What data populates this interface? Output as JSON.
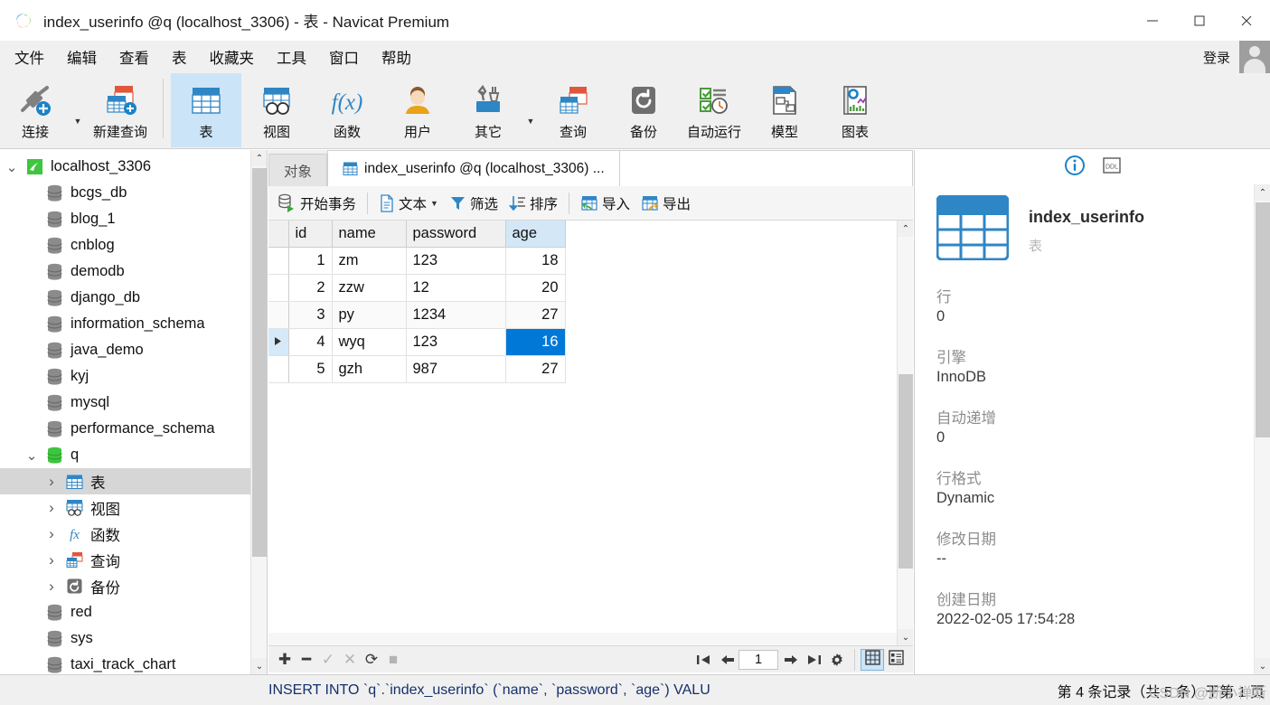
{
  "window": {
    "title": "index_userinfo @q (localhost_3306) - 表 - Navicat Premium",
    "minimize": "—",
    "maximize": "□",
    "close": "✕"
  },
  "menubar": {
    "items": [
      "文件",
      "编辑",
      "查看",
      "表",
      "收藏夹",
      "工具",
      "窗口",
      "帮助"
    ],
    "login_label": "登录"
  },
  "toolbar": {
    "buttons": [
      {
        "label": "连接",
        "icon": "connection-icon",
        "caret": true,
        "selected": false
      },
      {
        "label": "新建查询",
        "icon": "new-query-icon",
        "caret": false,
        "selected": false
      },
      {
        "label": "表",
        "icon": "table-icon",
        "caret": false,
        "selected": true
      },
      {
        "label": "视图",
        "icon": "view-icon",
        "caret": false,
        "selected": false
      },
      {
        "label": "函数",
        "icon": "function-icon",
        "caret": false,
        "selected": false
      },
      {
        "label": "用户",
        "icon": "user-icon",
        "caret": false,
        "selected": false
      },
      {
        "label": "其它",
        "icon": "other-icon",
        "caret": true,
        "selected": false
      },
      {
        "label": "查询",
        "icon": "query-icon",
        "caret": false,
        "selected": false
      },
      {
        "label": "备份",
        "icon": "backup-icon",
        "caret": false,
        "selected": false
      },
      {
        "label": "自动运行",
        "icon": "automation-icon",
        "caret": false,
        "selected": false
      },
      {
        "label": "模型",
        "icon": "model-icon",
        "caret": false,
        "selected": false
      },
      {
        "label": "图表",
        "icon": "chart-icon",
        "caret": false,
        "selected": false
      }
    ]
  },
  "sidebar": {
    "nodes": [
      {
        "label": "localhost_3306",
        "icon": "mysql-connection-icon",
        "indent": 0,
        "twisty": "down",
        "selected": false
      },
      {
        "label": "bcgs_db",
        "icon": "database-icon",
        "indent": 1,
        "twisty": "",
        "selected": false
      },
      {
        "label": "blog_1",
        "icon": "database-icon",
        "indent": 1,
        "twisty": "",
        "selected": false
      },
      {
        "label": "cnblog",
        "icon": "database-icon",
        "indent": 1,
        "twisty": "",
        "selected": false
      },
      {
        "label": "demodb",
        "icon": "database-icon",
        "indent": 1,
        "twisty": "",
        "selected": false
      },
      {
        "label": "django_db",
        "icon": "database-icon",
        "indent": 1,
        "twisty": "",
        "selected": false
      },
      {
        "label": "information_schema",
        "icon": "database-icon",
        "indent": 1,
        "twisty": "",
        "selected": false
      },
      {
        "label": "java_demo",
        "icon": "database-icon",
        "indent": 1,
        "twisty": "",
        "selected": false
      },
      {
        "label": "kyj",
        "icon": "database-icon",
        "indent": 1,
        "twisty": "",
        "selected": false
      },
      {
        "label": "mysql",
        "icon": "database-icon",
        "indent": 1,
        "twisty": "",
        "selected": false
      },
      {
        "label": "performance_schema",
        "icon": "database-icon",
        "indent": 1,
        "twisty": "",
        "selected": false
      },
      {
        "label": "q",
        "icon": "database-open-icon",
        "indent": 1,
        "twisty": "down",
        "selected": false
      },
      {
        "label": "表",
        "icon": "table-icon",
        "indent": 2,
        "twisty": "right",
        "selected": true
      },
      {
        "label": "视图",
        "icon": "view-icon",
        "indent": 2,
        "twisty": "right",
        "selected": false
      },
      {
        "label": "函数",
        "icon": "function-icon",
        "indent": 2,
        "twisty": "right",
        "selected": false
      },
      {
        "label": "查询",
        "icon": "query-icon",
        "indent": 2,
        "twisty": "right",
        "selected": false
      },
      {
        "label": "备份",
        "icon": "backup-icon",
        "indent": 2,
        "twisty": "right",
        "selected": false
      },
      {
        "label": "red",
        "icon": "database-icon",
        "indent": 1,
        "twisty": "",
        "selected": false
      },
      {
        "label": "sys",
        "icon": "database-icon",
        "indent": 1,
        "twisty": "",
        "selected": false
      },
      {
        "label": "taxi_track_chart",
        "icon": "database-icon",
        "indent": 1,
        "twisty": "",
        "selected": false
      }
    ]
  },
  "tabs": [
    {
      "label": "对象",
      "icon": "",
      "active": false
    },
    {
      "label": "index_userinfo @q (localhost_3306) ...",
      "icon": "table-icon",
      "active": true
    }
  ],
  "gridtools": [
    {
      "label": "开始事务",
      "icon": "transaction-icon",
      "caret": false
    },
    {
      "label": "文本",
      "icon": "text-icon",
      "caret": true
    },
    {
      "label": "筛选",
      "icon": "filter-icon",
      "caret": false
    },
    {
      "label": "排序",
      "icon": "sort-icon",
      "caret": false
    },
    {
      "label": "导入",
      "icon": "import-icon",
      "caret": false
    },
    {
      "label": "导出",
      "icon": "export-icon",
      "caret": false
    }
  ],
  "grid": {
    "columns": [
      "id",
      "name",
      "password",
      "age"
    ],
    "highlighted_column": "age",
    "rows": [
      {
        "id": "1",
        "name": "zm",
        "password": "123",
        "age": "18",
        "current": false
      },
      {
        "id": "2",
        "name": "zzw",
        "password": "12",
        "age": "20",
        "current": false
      },
      {
        "id": "3",
        "name": "py",
        "password": "1234",
        "age": "27",
        "current": false
      },
      {
        "id": "4",
        "name": "wyq",
        "password": "123",
        "age": "16",
        "current": true
      },
      {
        "id": "5",
        "name": "gzh",
        "password": "987",
        "age": "27",
        "current": false
      }
    ],
    "selected_cell": {
      "row": 4,
      "column": "age",
      "value": "16"
    }
  },
  "gridbottom": {
    "actions": [
      {
        "icon": "add-record-icon",
        "glyph": "✚",
        "dim": false
      },
      {
        "icon": "delete-record-icon",
        "glyph": "━",
        "dim": false
      },
      {
        "icon": "apply-change-icon",
        "glyph": "✓",
        "dim": true
      },
      {
        "icon": "cancel-change-icon",
        "glyph": "✕",
        "dim": true
      },
      {
        "icon": "refresh-icon",
        "glyph": "⟳",
        "dim": false
      },
      {
        "icon": "stop-icon",
        "glyph": "■",
        "dim": true
      }
    ],
    "pagination": {
      "first": "⏮",
      "prev": "←",
      "page": "1",
      "next": "→",
      "last": "⏭",
      "settings": "⚙"
    },
    "view_modes": [
      {
        "icon": "grid-view-icon",
        "selected": true
      },
      {
        "icon": "form-view-icon",
        "selected": false
      }
    ]
  },
  "infopanel": {
    "head_icons": [
      {
        "icon": "info-icon",
        "glyph": "i",
        "selected": true
      },
      {
        "icon": "ddl-icon",
        "glyph": "DDL",
        "selected": false
      }
    ],
    "object_name": "index_userinfo",
    "object_type": "表",
    "fields": [
      {
        "key": "行",
        "value": "0"
      },
      {
        "key": "引擎",
        "value": "InnoDB"
      },
      {
        "key": "自动递增",
        "value": "0"
      },
      {
        "key": "行格式",
        "value": "Dynamic"
      },
      {
        "key": "修改日期",
        "value": "--"
      },
      {
        "key": "创建日期",
        "value": "2022-02-05 17:54:28"
      }
    ]
  },
  "statusbar": {
    "sql": "INSERT INTO `q`.`index_userinfo` (`name`, `password`, `age`) VALU",
    "record_info": "第 4 条记录（共 5 条）于第 1 页",
    "watermark": "CSDN @断小禅断"
  },
  "colors": {
    "accent": "#0078d7",
    "selection": "#cce4f7",
    "header_highlight": "#d3e7f7",
    "toolbar_bg": "#f0f0f0"
  }
}
